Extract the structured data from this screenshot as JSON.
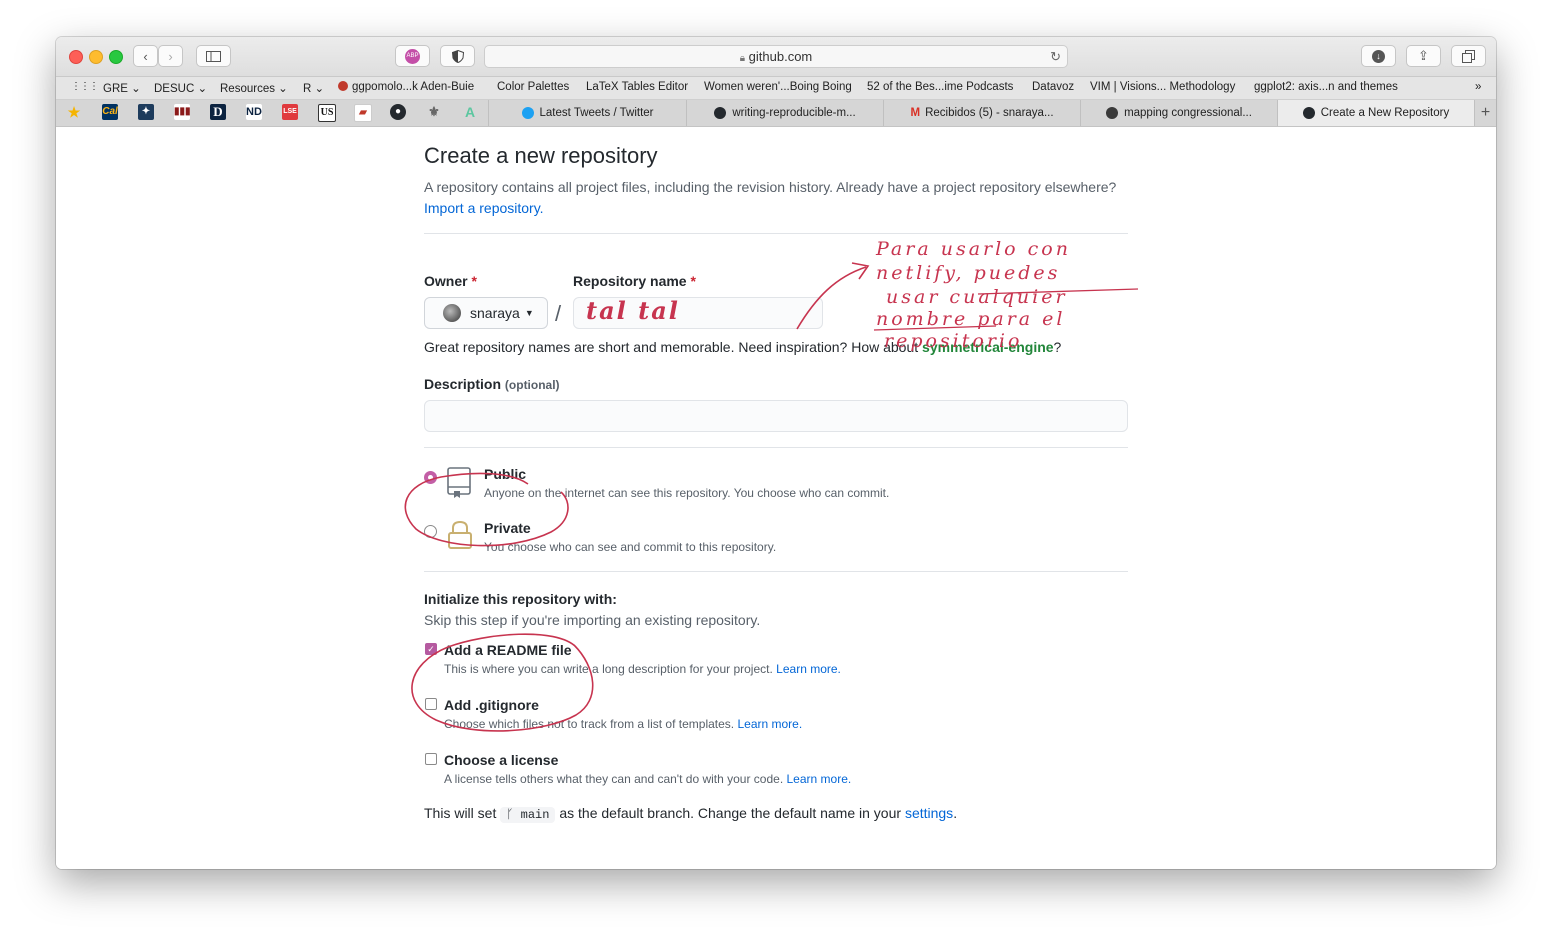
{
  "browser": {
    "url": "github.com",
    "bookmarks": [
      "GRE",
      "DESUC",
      "Resources",
      "R",
      "ggpomolo...k Aden-Buie",
      "Color Palettes",
      "LaTeX Tables Editor",
      "Women weren'...Boing Boing",
      "52 of the Bes...ime Podcasts",
      "Datavoz",
      "VIM | Visions... Methodology",
      "ggplot2: axis...n and themes"
    ],
    "pinned_tabs": [
      "star",
      "Cal",
      "crest",
      "bars",
      "D",
      "ND",
      "LSE",
      "US",
      "flag",
      "github",
      "emblem",
      "A"
    ],
    "tabs": [
      {
        "label": "Latest Tweets / Twitter",
        "color": "#1da1f2"
      },
      {
        "label": "writing-reproducible-m...",
        "color": "#24292e"
      },
      {
        "label": "Recibidos (5) - snaraya...",
        "color": "#d93025"
      },
      {
        "label": "mapping congressional...",
        "color": "#3a3a3a"
      },
      {
        "label": "Create a New Repository",
        "color": "#24292e"
      }
    ]
  },
  "page": {
    "title": "Create a new repository",
    "intro_text": "A repository contains all project files, including the revision history. Already have a project repository elsewhere?",
    "import_link": "Import a repository.",
    "owner_label": "Owner",
    "repo_label": "Repository name",
    "required_mark": "*",
    "owner_value": "snaraya",
    "slash": "/",
    "hint_text": "Great repository names are short and memorable. Need inspiration? How about",
    "suggestion": "symmetrical-engine",
    "hint_end": "?",
    "description_label": "Description",
    "optional_label": "(optional)",
    "public_title": "Public",
    "public_desc": "Anyone on the internet can see this repository. You choose who can commit.",
    "private_title": "Private",
    "private_desc": "You choose who can see and commit to this repository.",
    "init_title": "Initialize this repository with:",
    "init_desc": "Skip this step if you're importing an existing repository.",
    "readme_title": "Add a README file",
    "readme_desc": "This is where you can write a long description for your project.",
    "gitignore_title": "Add .gitignore",
    "gitignore_desc": "Choose which files not to track from a list of templates.",
    "license_title": "Choose a license",
    "license_desc": "A license tells others what they can and can't do with your code.",
    "learn_more": "Learn more.",
    "branch_pre": "This will set",
    "branch_name": "main",
    "branch_post": "as the default branch. Change the default name in your",
    "settings_link": "settings",
    "period": "."
  },
  "annotation": {
    "repo_name_handwriting": "tal tal",
    "note_lines": [
      "Para usarlo con",
      "netlify, puedes",
      "usar cualquier",
      "nombre para el",
      "repositorio"
    ],
    "ink_color": "#c7344f"
  }
}
